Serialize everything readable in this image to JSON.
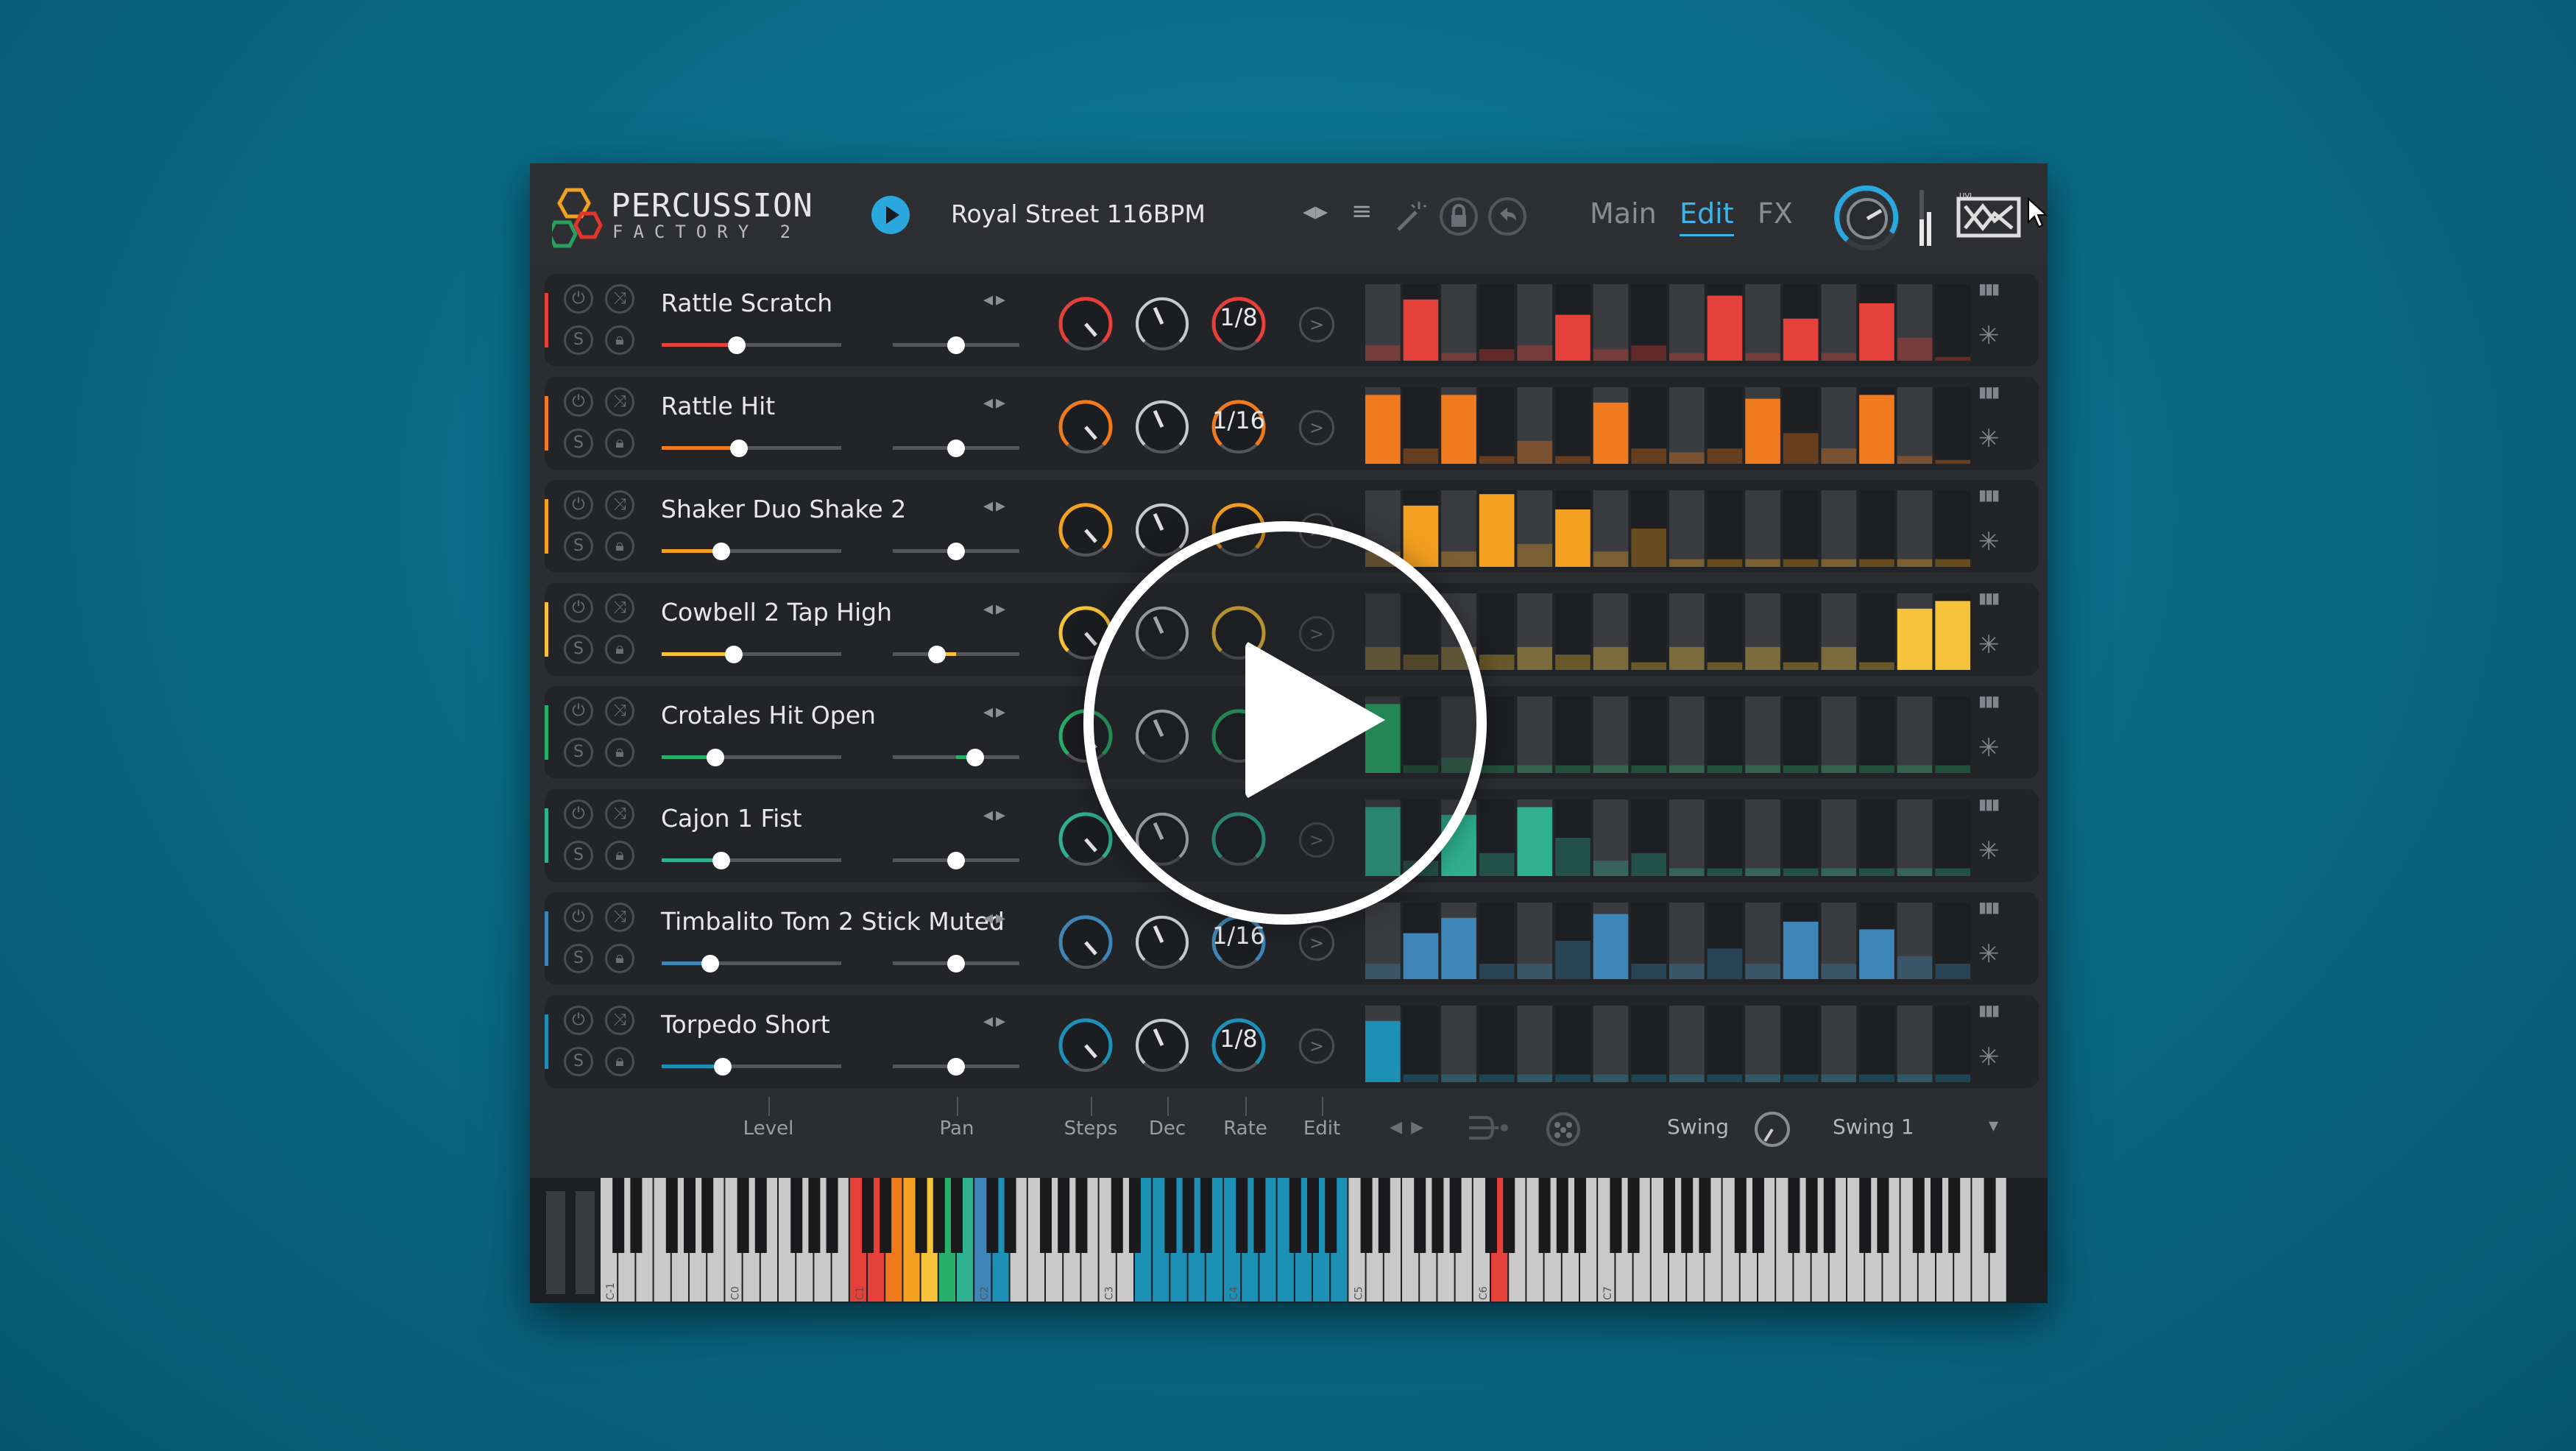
{
  "brand": {
    "line1": "PERCUSSION",
    "line2": "FACTORY 2"
  },
  "header": {
    "preset": "Royal Street 116BPM",
    "tabs": [
      "Main",
      "Edit",
      "FX"
    ],
    "active_tab": "Edit"
  },
  "tracks": [
    {
      "name": "Rattle Scratch",
      "color": "#e5403a",
      "level": 0.42,
      "pan": 0.5,
      "rate": "1/8",
      "cells": [
        0.2,
        0.8,
        0.1,
        0.15,
        0.2,
        0.6,
        0.15,
        0.2,
        0.1,
        0.85,
        0.1,
        0.55,
        0.1,
        0.75,
        0.3,
        0.05
      ]
    },
    {
      "name": "Rattle Hit",
      "color": "#f07a1e",
      "level": 0.43,
      "pan": 0.5,
      "rate": "1/16",
      "cells": [
        0.9,
        0.2,
        0.9,
        0.1,
        0.3,
        0.1,
        0.8,
        0.2,
        0.15,
        0.2,
        0.85,
        0.4,
        0.2,
        0.9,
        0.1,
        0.05
      ]
    },
    {
      "name": "Shaker Duo Shake 2",
      "color": "#f4a020",
      "level": 0.33,
      "pan": 0.5,
      "rate": "",
      "cells": [
        0.2,
        0.8,
        0.2,
        0.95,
        0.3,
        0.75,
        0.2,
        0.5,
        0.1,
        0.1,
        0.1,
        0.1,
        0.1,
        0.1,
        0.1,
        0.1
      ]
    },
    {
      "name": "Cowbell 2 Tap High",
      "color": "#f6c23a",
      "level": 0.4,
      "pan": 0.35,
      "rate": "",
      "cells": [
        0.3,
        0.2,
        0.3,
        0.2,
        0.3,
        0.2,
        0.3,
        0.1,
        0.3,
        0.1,
        0.3,
        0.1,
        0.3,
        0.1,
        0.8,
        0.9
      ]
    },
    {
      "name": "Crotales Hit Open",
      "color": "#27b06a",
      "level": 0.3,
      "pan": 0.65,
      "rate": "",
      "cells": [
        0.9,
        0.1,
        0.2,
        0.1,
        0.1,
        0.1,
        0.1,
        0.1,
        0.1,
        0.1,
        0.1,
        0.1,
        0.1,
        0.1,
        0.1,
        0.1
      ]
    },
    {
      "name": "Cajon 1 Fist",
      "color": "#2fb090",
      "level": 0.33,
      "pan": 0.5,
      "rate": "",
      "cells": [
        0.9,
        0.2,
        0.8,
        0.3,
        0.9,
        0.5,
        0.2,
        0.3,
        0.1,
        0.1,
        0.1,
        0.1,
        0.1,
        0.1,
        0.1,
        0.1
      ]
    },
    {
      "name": "Timbalito Tom 2 Stick Muted",
      "color": "#3f86b8",
      "level": 0.27,
      "pan": 0.5,
      "rate": "1/16",
      "cells": [
        0.2,
        0.6,
        0.8,
        0.2,
        0.2,
        0.5,
        0.85,
        0.2,
        0.2,
        0.4,
        0.2,
        0.75,
        0.2,
        0.65,
        0.3,
        0.2
      ]
    },
    {
      "name": "Torpedo Short",
      "color": "#1d90b5",
      "level": 0.34,
      "pan": 0.5,
      "rate": "1/8",
      "cells": [
        0.8,
        0.1,
        0.1,
        0.1,
        0.1,
        0.1,
        0.1,
        0.1,
        0.1,
        0.1,
        0.1,
        0.1,
        0.1,
        0.1,
        0.1,
        0.1
      ]
    }
  ],
  "footer": {
    "level": "Level",
    "pan": "Pan",
    "steps": "Steps",
    "dec": "Dec",
    "rate": "Rate",
    "edit": "Edit",
    "swing_label": "Swing",
    "swing_value": "Swing 1"
  },
  "keyboard": {
    "octave_labels": [
      "C-1",
      "C0",
      "C1",
      "C2",
      "C3",
      "C4",
      "C5",
      "C6",
      "C7"
    ]
  },
  "icons": [
    "prev-next-icon",
    "menu-icon",
    "magic-wand-icon",
    "lock-icon",
    "undo-icon",
    "volume-knob-icon",
    "uvi-logo-icon",
    "power-icon",
    "shuffle-icon",
    "solo-icon",
    "lock-icon",
    "chevron-right-icon",
    "bars-icon",
    "magic-wand-icon",
    "dice-icon",
    "play-icon"
  ]
}
